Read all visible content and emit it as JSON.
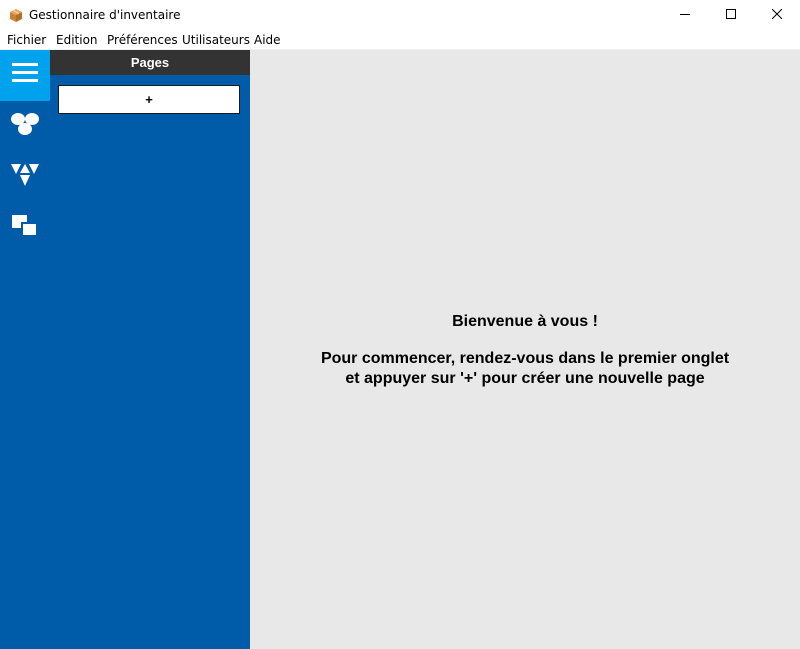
{
  "window": {
    "title": "Gestionnaire d'inventaire",
    "icon": "package-icon",
    "controls": [
      "minimize-icon",
      "maximize-icon",
      "close-icon"
    ]
  },
  "menu": {
    "items": [
      "Fichier",
      "Edition",
      "Préférences",
      "Utilisateurs",
      "Aide"
    ]
  },
  "sidebar": {
    "items": [
      {
        "icon": "hamburger-menu-icon",
        "active": true
      },
      {
        "icon": "circles-group-icon",
        "active": false
      },
      {
        "icon": "triangles-group-icon",
        "active": false
      },
      {
        "icon": "squares-group-icon",
        "active": false
      }
    ]
  },
  "pages_panel": {
    "header": "Pages",
    "add_button_label": "+"
  },
  "content": {
    "welcome_title": "Bienvenue à vous !",
    "welcome_line1": "Pour commencer, rendez-vous dans le premier onglet",
    "welcome_line2": "et appuyer sur '+' pour créer une nouvelle page"
  },
  "colors": {
    "sidebar": "#005ca8",
    "sidebar_active": "#00a2ed",
    "panel_header": "#333333",
    "content_bg": "#e8e8e8"
  }
}
